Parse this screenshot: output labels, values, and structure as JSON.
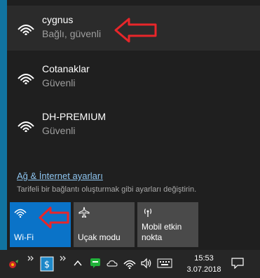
{
  "networks": [
    {
      "name": "cygnus",
      "status": "Bağlı, güvenli"
    },
    {
      "name": "Cotanaklar",
      "status": "Güvenli"
    },
    {
      "name": "DH-PREMIUM",
      "status": "Güvenli"
    }
  ],
  "settings": {
    "link": "Ağ & İnternet ayarları",
    "description": "Tarifeli bir bağlantı oluşturmak gibi ayarları değiştirin."
  },
  "tiles": {
    "wifi": "Wi-Fi",
    "airplane": "Uçak modu",
    "mobile_line1": "Mobil etkin",
    "mobile_line2": "nokta"
  },
  "clock": {
    "time": "15:53",
    "date": "3.07.2018"
  },
  "colors": {
    "accent": "#0a73c8",
    "annotation": "#e8262a"
  }
}
